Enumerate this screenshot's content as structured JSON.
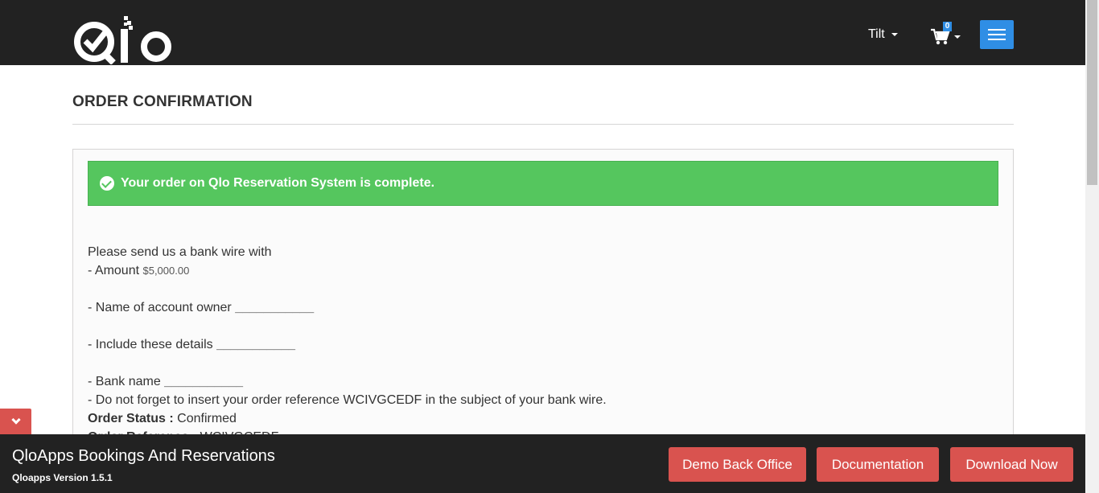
{
  "header": {
    "logo_text": "Qlo",
    "user_name": "Tilt",
    "cart_count": "0",
    "icons": [
      "qlo-logo",
      "cart-icon",
      "hamburger-menu-icon",
      "caret-down-icon"
    ]
  },
  "page": {
    "title": "ORDER CONFIRMATION"
  },
  "alert": {
    "message": "Your order on Qlo Reservation System is complete.",
    "icon": "check-circle-icon",
    "color": "#55c65e"
  },
  "details": {
    "intro": "Please send us a bank wire with",
    "amount_label": "- Amount ",
    "amount_value": "$5,000.00",
    "owner_label": "- Name of account owner ",
    "owner_value": "___________",
    "include_label": "- Include these details ",
    "include_value": "___________",
    "bank_label": "- Bank name ",
    "bank_value": "___________",
    "reference_note": "- Do not forget to insert your order reference WCIVGCEDF in the subject of your bank wire.",
    "status_label": "Order Status : ",
    "status_value": "Confirmed",
    "reference_label": "Order Reference : ",
    "reference_value": "WCIVGCEDF"
  },
  "bottom_bar": {
    "title": "QloApps Bookings And Reservations",
    "version": "Qloapps Version 1.5.1",
    "buttons": {
      "demo": "Demo Back Office",
      "docs": "Documentation",
      "download": "Download Now"
    },
    "collapse_icon": "chevron-down-icon",
    "accent_color": "#d9534f"
  }
}
